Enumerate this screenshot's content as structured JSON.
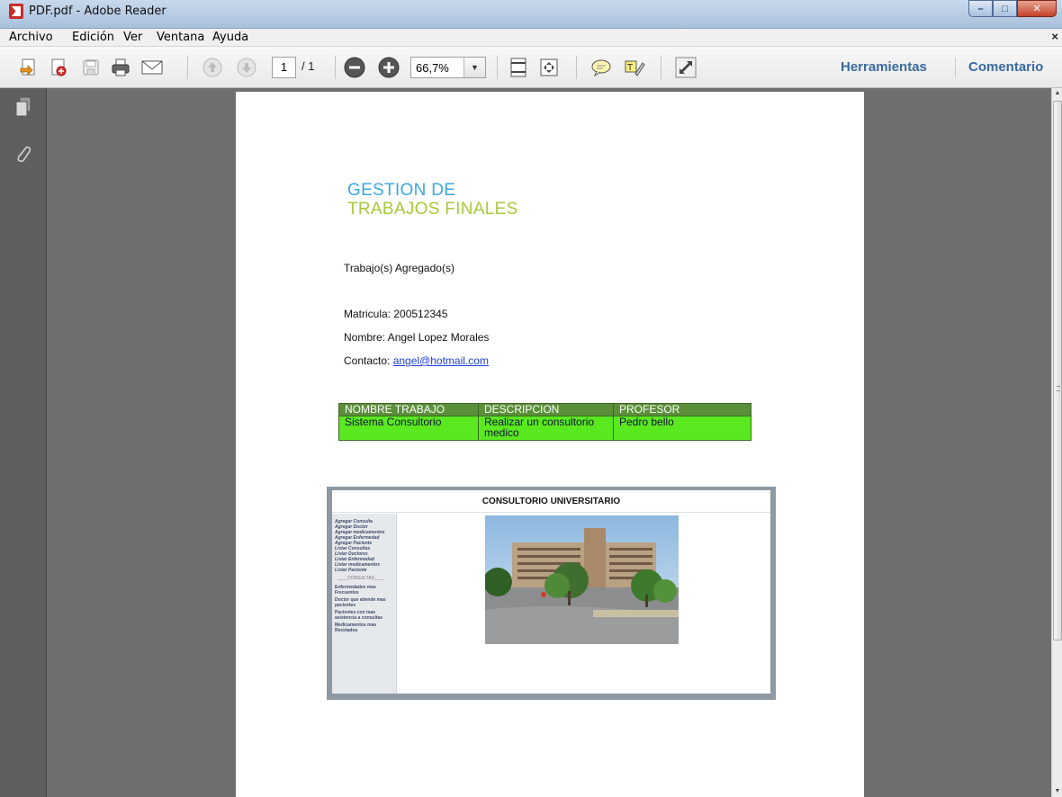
{
  "window": {
    "title": "PDF.pdf - Adobe Reader",
    "minimize_glyph": "–",
    "maximize_glyph": "□",
    "close_glyph": "✕"
  },
  "menubar": {
    "items": [
      "Archivo",
      "Edición",
      "Ver",
      "Ventana",
      "Ayuda"
    ],
    "close_glyph": "×"
  },
  "toolbar": {
    "page_current": "1",
    "page_total": "/ 1",
    "zoom": "66,7%",
    "zoom_dropdown_glyph": "▼",
    "herramientas": "Herramientas",
    "comentario": "Comentario"
  },
  "document": {
    "heading_line1": "GESTION DE",
    "heading_line2": "TRABAJOS FINALES",
    "section_title": "Trabajo(s) Agregado(s)",
    "matricula": "Matricula: 200512345",
    "nombre": "Nombre: Angel Lopez Morales",
    "contacto_label": "Contacto: ",
    "contacto_email": "angel@hotmail.com",
    "table": {
      "headers": [
        "NOMBRE TRABAJO",
        "DESCRIPCION",
        "PROFESOR"
      ],
      "rows": [
        [
          "Sistema Consultorio",
          "Realizar un consultorio medico",
          "Pedro bello"
        ]
      ]
    },
    "embedded": {
      "title": "CONSULTORIO UNIVERSITARIO",
      "menu_items": [
        "Agregar Consulta",
        "Agregar Doctor",
        "Agregar medicamentos",
        "Agregar Enfermedad",
        "Agregar Paciente",
        "Listar Consultas",
        "Listar Doctores",
        "Listar Enfermedad",
        "Listar medicamentos",
        "Listar Paciente"
      ],
      "consultas_header": "____CONSULTAS____",
      "consultas_items": [
        "Enfermedades mas Frecuentes",
        "Doctor que atiende mas pacientes",
        "Pacientes con mas asistencia a consultas",
        "Medicamentos mas Recetados"
      ]
    }
  },
  "colors": {
    "heading_blue": "#3aa8e0",
    "heading_green": "#a6c93b",
    "table_header": "#5c8f3a",
    "table_row": "#5ae81f",
    "link_blue": "#3a6aa1"
  }
}
